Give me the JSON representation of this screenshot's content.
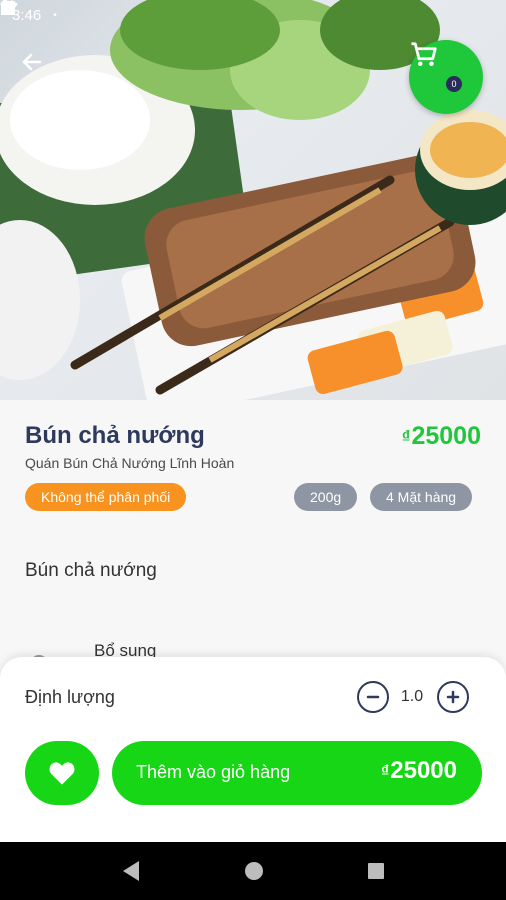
{
  "status_bar": {
    "time": "3:46"
  },
  "product": {
    "name": "Bún chả nướng",
    "currency": "₫",
    "price": "25000",
    "store": "Quán Bún Chả Nướng Lĩnh Hoàn",
    "availability_badge": "Không thể phân phối",
    "weight_badge": "200g",
    "items_badge": "4 Mặt hàng",
    "description": "Bún chả nướng",
    "addon_label": "Bổ sung"
  },
  "cart": {
    "count": "0"
  },
  "bottom_sheet": {
    "quantity_label": "Định lượng",
    "quantity_value": "1.0",
    "add_to_cart_label": "Thêm vào giỏ hàng",
    "currency": "₫",
    "total_price": "25000"
  },
  "colors": {
    "accent": "#1fc73b",
    "title": "#2d3a5c",
    "orange": "#f7931e",
    "gray_badge": "#8f96a3"
  },
  "icons": [
    "back-arrow-icon",
    "cart-icon",
    "heart-icon",
    "minus-icon",
    "plus-icon",
    "nav-back-icon",
    "nav-home-icon",
    "nav-recents-icon"
  ]
}
